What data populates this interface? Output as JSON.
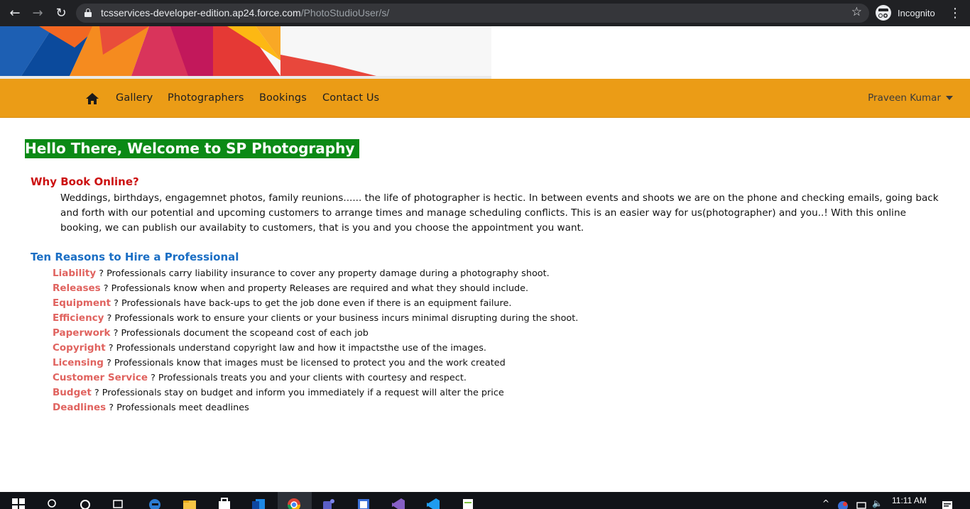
{
  "browser": {
    "url_host": "tcsservices-developer-edition.ap24.force.com",
    "url_path": "/PhotoStudioUser/s/",
    "incognito_label": "Incognito"
  },
  "nav": {
    "links": [
      "Gallery",
      "Photographers",
      "Bookings",
      "Contact Us"
    ],
    "user_name": "Praveen Kumar",
    "bar_color": "#eb9c16"
  },
  "content": {
    "welcome": "Hello There, Welcome to SP Photography",
    "why_heading": "Why Book Online?",
    "why_text": "Weddings, birthdays, engagemnet photos, family reunions...... the life of photographer is hectic. In between events and shoots we are on the phone and checking emails, going back and forth with our potential and upcoming customers to arrange times and manage scheduling conflicts. This is an easier way for us(photographer) and you..! With this online booking, we can publish our  availabity to customers, that is you and you choose the appointment you want.",
    "ten_heading": "Ten Reasons to Hire a Professional",
    "reasons": [
      {
        "title": "Liability",
        "text": " ? Professionals carry liability insurance to cover any property damage during a photography shoot."
      },
      {
        "title": "Releases",
        "text": " ? Professionals know when and property Releases are required and what they should include."
      },
      {
        "title": "Equipment",
        "text": " ? Professionals  have back-ups to get the job done even if there is an equipment failure."
      },
      {
        "title": "Efficiency",
        "text": " ? Professionals work to ensure your clients or your business incurs minimal disrupting during the shoot."
      },
      {
        "title": "Paperwork",
        "text": " ? Professionals document the scopeand cost of each job"
      },
      {
        "title": "Copyright",
        "text": " ? Professionals  understand copyright law and how it impactsthe use of the images."
      },
      {
        "title": "Licensing",
        "text": " ? Professionals know that images must be licensed to protect you and the work created"
      },
      {
        "title": "Customer Service",
        "text": " ? Professionals treats you and your clients with courtesy and respect."
      },
      {
        "title": "Budget",
        "text": " ? Professionals stay on budget and inform you immediately if a request will alter the price"
      },
      {
        "title": "Deadlines",
        "text": " ? Professionals meet deadlines"
      }
    ],
    "colors": {
      "welcome_bg": "#0b8a16",
      "why_heading": "#cc1111",
      "ten_heading": "#1a6ec4",
      "reason_title": "#e0635f"
    }
  },
  "taskbar": {
    "time": "11:11 AM"
  }
}
